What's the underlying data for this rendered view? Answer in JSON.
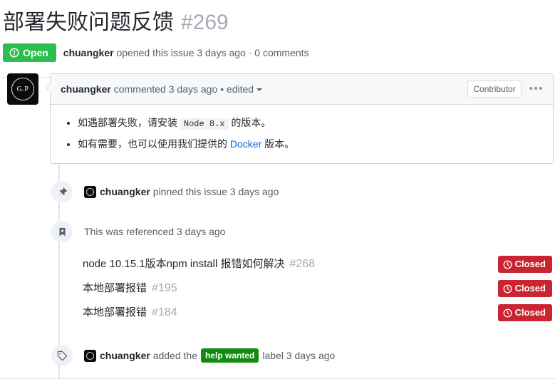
{
  "issue": {
    "title": "部署失败问题反馈",
    "number": "#269",
    "state_label": "Open",
    "state_color": "#2cbe4e",
    "byline_author": "chuangker",
    "byline_text": "opened this issue 3 days ago · 0 comments"
  },
  "comment": {
    "author": "chuangker",
    "meta": "commented 3 days ago •",
    "edited_label": "edited",
    "contributor_badge": "Contributor",
    "kebab_label": "•••",
    "bullets": [
      {
        "pre": "如遇部署失败，请安装 ",
        "code": "Node 8.x",
        "post": " 的版本。"
      },
      {
        "pre": "如有需要，也可以使用我们提供的 ",
        "link": "Docker",
        "post": " 版本。"
      }
    ]
  },
  "events": [
    {
      "icon": "pin-icon",
      "avatar_initials": "",
      "author": "chuangker",
      "text": "pinned this issue 3 days ago"
    },
    {
      "icon": "bookmark-icon",
      "text": "This was referenced 3 days ago"
    }
  ],
  "referenced_issues": [
    {
      "title": "node 10.15.1版本npm install 报错如何解决",
      "number": "#268",
      "status": "Closed",
      "status_color": "#cb2431"
    },
    {
      "title": "本地部署报错",
      "number": "#195",
      "status": "Closed",
      "status_color": "#cb2431"
    },
    {
      "title": "本地部署报错",
      "number": "#184",
      "status": "Closed",
      "status_color": "#cb2431"
    }
  ],
  "label_event": {
    "icon": "tag-icon",
    "author": "chuangker",
    "text_before": "added the",
    "label": "help wanted",
    "label_color": "#128a0c",
    "text_after": "label 3 days ago"
  }
}
